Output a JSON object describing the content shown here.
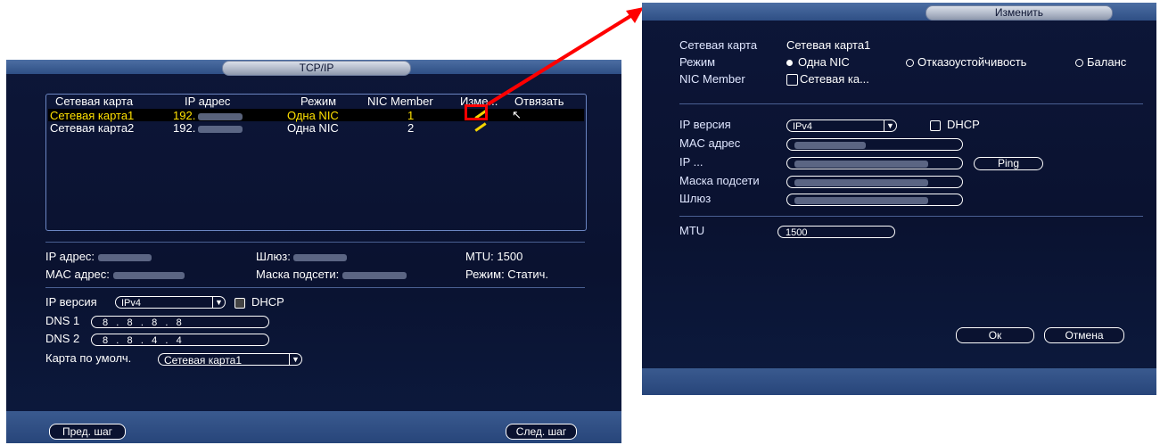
{
  "left_window": {
    "title": "TCP/IP",
    "table": {
      "headers": [
        "Сетевая карта",
        "IP адрес",
        "Режим",
        "NIC Member",
        "Изме...",
        "Отвязать"
      ],
      "rows": [
        {
          "card": "Сетевая карта1",
          "ip": "192.",
          "mode": "Одна NIC",
          "member": "1"
        },
        {
          "card": "Сетевая карта2",
          "ip": "192.",
          "mode": "Одна NIC",
          "member": "2"
        }
      ]
    },
    "info": {
      "ip_label": "IP адрес:",
      "gateway_label": "Шлюз:",
      "mtu": "MTU: 1500",
      "mac_label": "MAC адрес:",
      "mask_label": "Маска подсети:",
      "mode": "Режим: Статич."
    },
    "ip_version_label": "IP версия",
    "ip_version_value": "IPv4",
    "dhcp_label": "DHCP",
    "dns1_label": "DNS 1",
    "dns1": [
      "8",
      "8",
      "8",
      "8"
    ],
    "dns2_label": "DNS 2",
    "dns2": [
      "8",
      "8",
      "4",
      "4"
    ],
    "default_card_label": "Карта по умолч.",
    "default_card_value": "Сетевая карта1",
    "prev_button": "Пред. шаг",
    "next_button": "След. шаг"
  },
  "right_window": {
    "title": "Изменить",
    "card_label": "Сетевая карта",
    "card_value": "Сетевая карта1",
    "mode_label": "Режим",
    "mode_options": [
      "Одна NIC",
      "Отказоустойчивость",
      "Баланс"
    ],
    "member_label": "NIC Member",
    "member_value": "Сетевая ка...",
    "ip_version_label": "IP версия",
    "ip_version_value": "IPv4",
    "dhcp_label": "DHCP",
    "mac_label": "MAC адрес",
    "ip_label": "IP ...",
    "ping_button": "Ping",
    "mask_label": "Маска подсети",
    "gateway_label": "Шлюз",
    "mtu_label": "MTU",
    "mtu_value": "1500",
    "ok_button": "Ок",
    "cancel_button": "Отмена"
  },
  "colors": {
    "window_bg": "#0a1230",
    "highlight_text": "#ffe100",
    "annotation": "#ff0000"
  }
}
